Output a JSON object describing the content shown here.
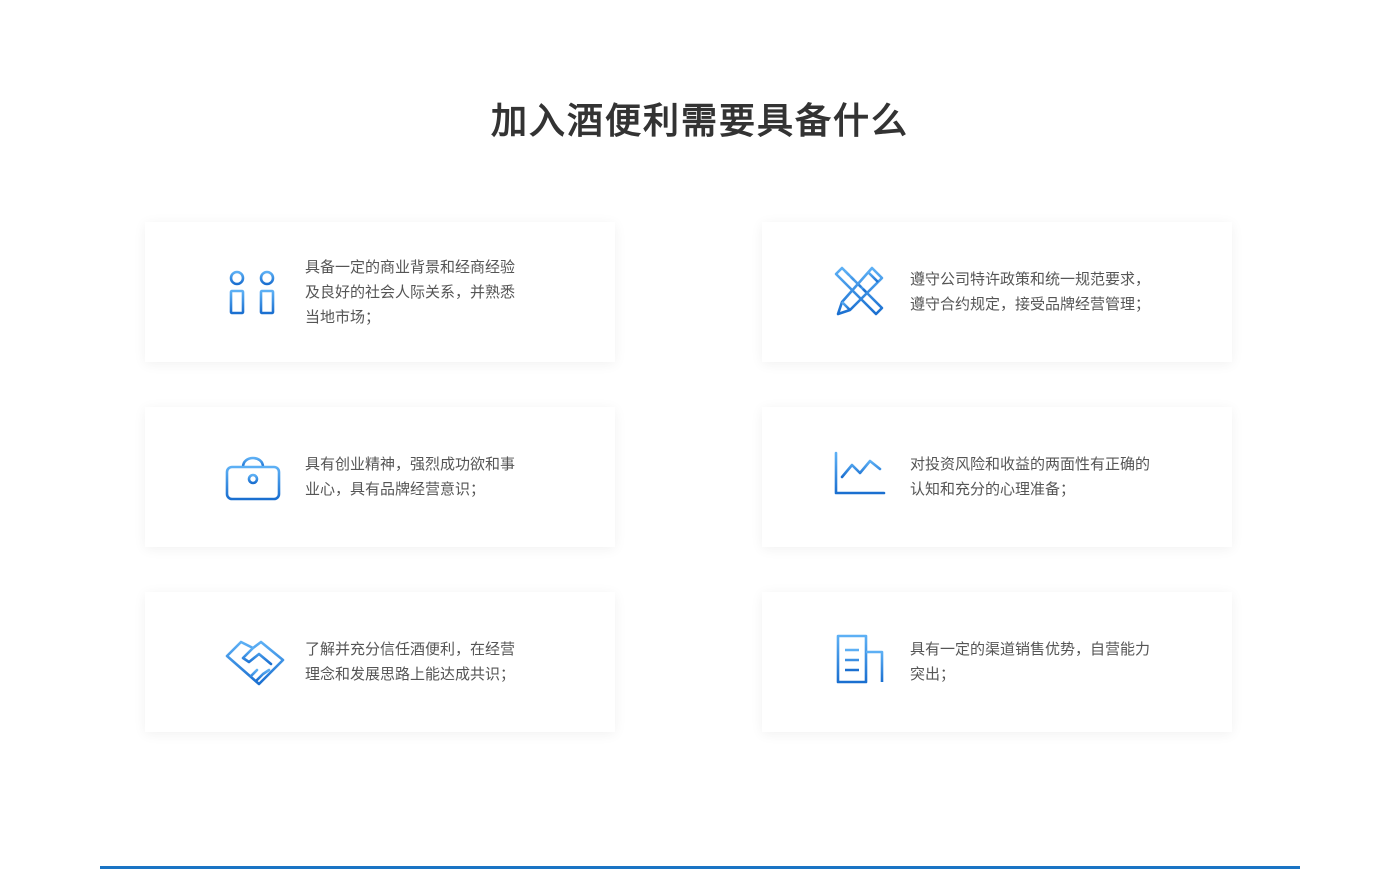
{
  "title": "加入酒便利需要具备什么",
  "cards": [
    {
      "icon": "people-icon",
      "text": "具备一定的商业背景和经商经验及良好的社会人际关系，并熟悉当地市场；"
    },
    {
      "icon": "ruler-pencil-icon",
      "text": "遵守公司特许政策和统一规范要求，遵守合约规定，接受品牌经营管理；"
    },
    {
      "icon": "briefcase-icon",
      "text": "具有创业精神，强烈成功欲和事业心，具有品牌经营意识；"
    },
    {
      "icon": "line-chart-icon",
      "text": "对投资风险和收益的两面性有正确的认知和充分的心理准备；"
    },
    {
      "icon": "handshake-icon",
      "text": "了解并充分信任酒便利，在经营理念和发展思路上能达成共识；"
    },
    {
      "icon": "building-icon",
      "text": "具有一定的渠道销售优势，自营能力突出；"
    }
  ],
  "colors": {
    "accent": "#1a74c4",
    "icon_light": "#4aa3f0",
    "icon_dark": "#1a6fd0"
  }
}
